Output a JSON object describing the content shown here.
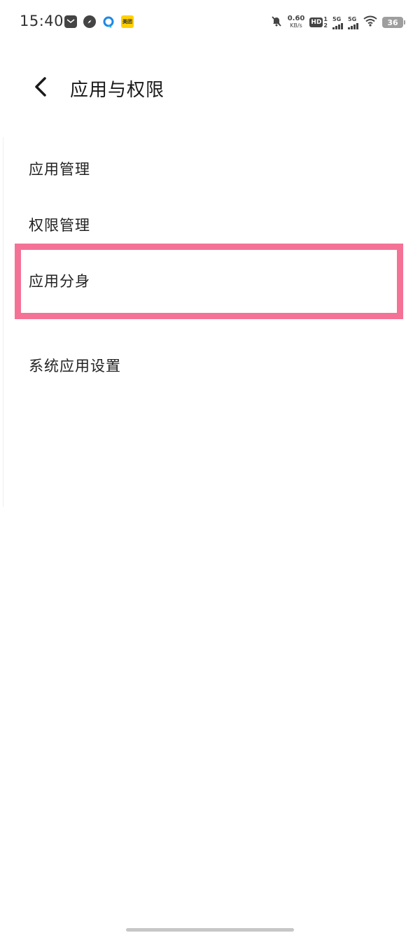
{
  "status_bar": {
    "time": "15:40",
    "notifications": [
      "mail-icon",
      "compass-icon",
      "browser-icon",
      "meituan-icon"
    ],
    "meituan_text": "美团",
    "net_speed_value": "0.60",
    "net_speed_unit": "KB/s",
    "hd_label": "HD",
    "hd_sim1": "1",
    "hd_sim2": "2",
    "sim1_label": "5G",
    "sim2_label": "5G",
    "battery": "36"
  },
  "header": {
    "title": "应用与权限",
    "back_icon": "chevron-left-icon"
  },
  "list": {
    "items": [
      {
        "label": "应用管理"
      },
      {
        "label": "权限管理"
      },
      {
        "label": "应用分身"
      },
      {
        "label": "系统应用设置"
      }
    ]
  },
  "highlight": {
    "target": "应用分身",
    "color": "#f47295"
  }
}
